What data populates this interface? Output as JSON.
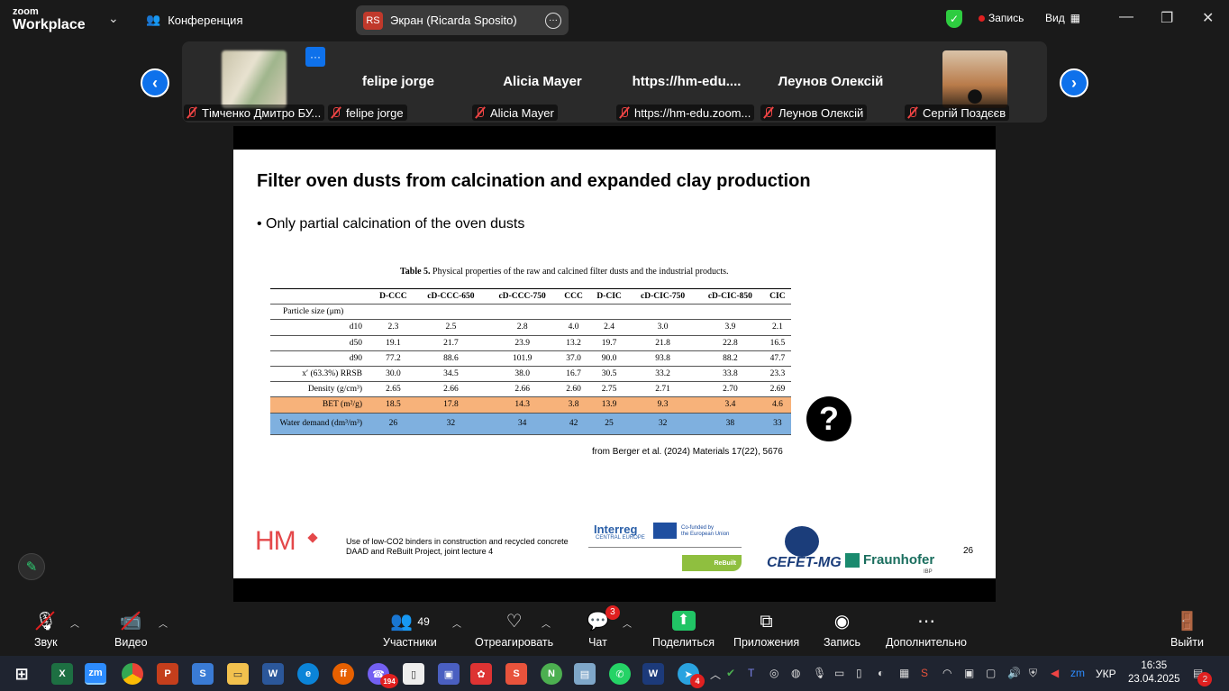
{
  "app": {
    "logo_small": "zoom",
    "logo_big": "Workplace",
    "conference_label": "Конференция",
    "screen_share_initials": "RS",
    "screen_share_label": "Экран (Ricarda Sposito)",
    "recording_label": "Запись",
    "view_label": "Вид",
    "accent_color": "#0e71eb"
  },
  "gallery": {
    "participants": [
      {
        "label": "Тімченко Дмитро БУ...",
        "big_name": "",
        "has_video": true
      },
      {
        "label": "felipe jorge",
        "big_name": "felipe jorge",
        "has_video": false
      },
      {
        "label": "Alicia Mayer",
        "big_name": "Alicia Mayer",
        "has_video": false
      },
      {
        "label": "https://hm-edu.zoom...",
        "big_name": "https://hm-edu....",
        "has_video": false
      },
      {
        "label": "Леунов Олексій",
        "big_name": "Леунов Олексій",
        "has_video": false
      },
      {
        "label": "Сергій Поздєєв",
        "big_name": "",
        "has_video": true
      }
    ]
  },
  "slide": {
    "title": "Filter oven dusts from calcination and expanded clay production",
    "bullet": "• Only partial calcination of the oven dusts",
    "table_caption_bold": "Table 5.",
    "table_caption": " Physical properties of the raw and calcined filter dusts and the industrial products.",
    "table_headers": [
      "",
      "D-CCC",
      "cD-CCC-650",
      "cD-CCC-750",
      "CCC",
      "D-CIC",
      "cD-CIC-750",
      "cD-CIC-850",
      "CIC"
    ],
    "table_rows": [
      [
        "Particle size (μm)",
        "",
        "",
        "",
        "",
        "",
        "",
        "",
        ""
      ],
      [
        "d10",
        "2.3",
        "2.5",
        "2.8",
        "4.0",
        "2.4",
        "3.0",
        "3.9",
        "2.1"
      ],
      [
        "d50",
        "19.1",
        "21.7",
        "23.9",
        "13.2",
        "19.7",
        "21.8",
        "22.8",
        "16.5"
      ],
      [
        "d90",
        "77.2",
        "88.6",
        "101.9",
        "37.0",
        "90.0",
        "93.8",
        "88.2",
        "47.7"
      ],
      [
        "x′ (63.3%) RRSB",
        "30.0",
        "34.5",
        "38.0",
        "16.7",
        "30.5",
        "33.2",
        "33.8",
        "23.3"
      ],
      [
        "Density (g/cm³)",
        "2.65",
        "2.66",
        "2.66",
        "2.60",
        "2.75",
        "2.71",
        "2.70",
        "2.69"
      ],
      [
        "BET (m²/g)",
        "18.5",
        "17.8",
        "14.3",
        "3.8",
        "13.9",
        "9.3",
        "3.4",
        "4.6"
      ],
      [
        "Water demand (dm³/m³)",
        "26",
        "32",
        "34",
        "42",
        "25",
        "32",
        "38",
        "33"
      ]
    ],
    "question_mark": "?",
    "source": "from Berger et al. (2024) Materials 17(22), 5676",
    "logo_hm": "HM",
    "footer_line1": "Use of low-CO2 binders in construction and recycled concrete",
    "footer_line2": "DAAD and ReBuilt Project, joint lecture 4",
    "interreg": "Interreg",
    "interreg_sub": "CENTRAL EUROPE",
    "eu_line1": "Co-funded by",
    "eu_line2": "the European Union",
    "rebuilt": "ReBuilt",
    "cefet": "CEFET-MG",
    "fraunhofer": "Fraunhofer",
    "ibp": "IBP",
    "page_number": "26"
  },
  "toolbar": {
    "audio": "Звук",
    "video": "Видео",
    "participants": "Участники",
    "participants_count": "49",
    "react": "Отреагировать",
    "chat": "Чат",
    "chat_badge": "3",
    "share": "Поделиться",
    "apps": "Приложения",
    "record": "Запись",
    "more": "Дополнительно",
    "leave": "Выйти"
  },
  "taskbar": {
    "viber_badge": "194",
    "telegram_badge": "4",
    "language": "УКР",
    "time": "16:35",
    "date": "23.04.2025",
    "notifications": "2"
  }
}
